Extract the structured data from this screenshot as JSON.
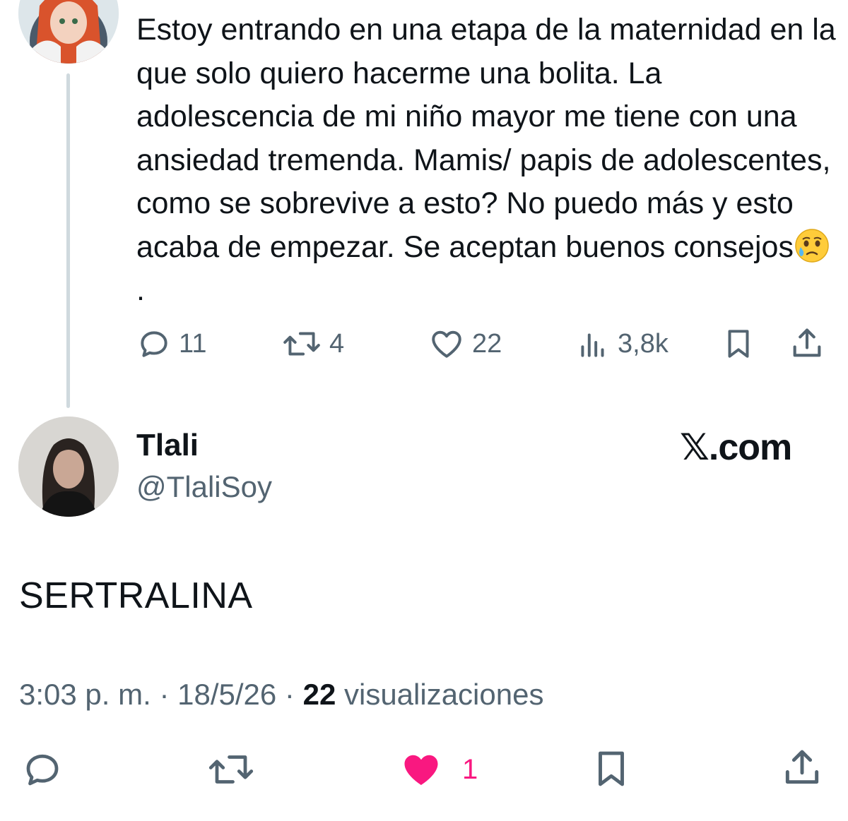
{
  "parent_tweet": {
    "text": "Estoy entrando en una etapa de la maternidad en la que solo quiero hacerme una bolita. La adolescencia de mi niño mayor me tiene con una ansiedad tremenda. Mamis/ papis de adolescentes, como se sobrevive a esto?  No puedo más y esto acaba de empezar. Se aceptan buenos consejos",
    "text_suffix": ".",
    "emoji": "face-holding-back-tears",
    "metrics": {
      "replies": "11",
      "reposts": "4",
      "likes": "22",
      "views": "3,8k"
    }
  },
  "reply_tweet": {
    "author_name": "Tlali",
    "author_handle": "@TlaliSoy",
    "brand": "𝕏.com",
    "text": "SERTRALINA",
    "time": "3:03 p. m.",
    "separator": "·",
    "date": "18/5/26",
    "views_count": "22",
    "views_label": "visualizaciones",
    "likes": "1"
  },
  "colors": {
    "text": "#0f1419",
    "secondary": "#536471",
    "like_pink": "#f91880",
    "thread_line": "#cfd9de"
  },
  "icons": [
    "reply-icon",
    "repost-icon",
    "like-icon",
    "views-icon",
    "bookmark-icon",
    "share-icon"
  ]
}
